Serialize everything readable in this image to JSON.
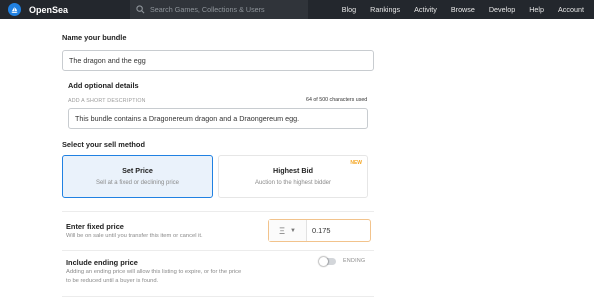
{
  "header": {
    "brand": "OpenSea",
    "search_placeholder": "Search Games, Collections & Users",
    "nav": [
      "Blog",
      "Rankings",
      "Activity",
      "Browse",
      "Develop",
      "Help",
      "Account"
    ]
  },
  "form": {
    "name_label": "Name your bundle",
    "name_value": "The dragon and the egg",
    "optional_label": "Add optional details",
    "description_caption": "ADD A SHORT DESCRIPTION",
    "description_count": "64 of 500 characters used",
    "description_value": "This bundle contains a Dragonereum dragon and a Draongereum egg.",
    "sell_method_label": "Select your sell method",
    "sell_options": [
      {
        "title": "Set Price",
        "subtitle": "Sell at a fixed or declining price",
        "selected": true
      },
      {
        "title": "Highest Bid",
        "subtitle": "Auction to the highest bidder",
        "badge": "NEW",
        "selected": false
      }
    ],
    "price_label": "Enter fixed price",
    "price_sub": "Will be on sale until you transfer this item or cancel it.",
    "currency_icon": "eth-icon",
    "price_value": "0.175",
    "ending_label": "Include ending price",
    "ending_sub_line1": "Adding an ending price will allow this listing to expire, or for the price",
    "ending_sub_line2": "to be reduced until a buyer is found.",
    "ending_toggle_label": "ENDING",
    "ending_toggle_on": false
  },
  "colors": {
    "topbar": "#23272d",
    "accent": "#2081e2",
    "price_border": "#f2c38c",
    "badge": "#f5a623"
  }
}
